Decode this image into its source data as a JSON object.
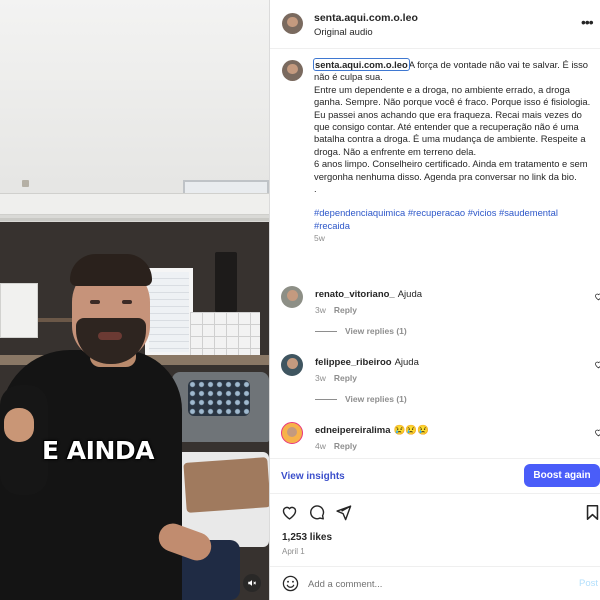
{
  "video": {
    "caption": "E AINDA",
    "mute_icon": "speaker-muted-icon"
  },
  "header": {
    "username": "senta.aqui.com.o.leo",
    "subtitle": "Original audio",
    "more_icon": "more-horizontal-icon",
    "more_glyph": "•••"
  },
  "post": {
    "username": "senta.aqui.com.o.leo",
    "lines": [
      "A força de vontade não vai te salvar. É isso não é culpa sua.",
      "Entre um dependente e a droga, no ambiente errado, a droga ganha. Sempre. Não porque você é fraco. Porque isso é fisiologia.",
      "Eu passei anos achando que era fraqueza. Recai mais vezes do que consigo contar. Até entender que a recuperação não é uma batalha contra a droga. É uma mudança de ambiente. Respeite a droga. Não a enfrente em terreno dela.",
      "6 anos limpo. Conselheiro certificado. Ainda em tratamento e sem vergonha nenhuma disso. Agenda pra conversar no link da bio.",
      "."
    ],
    "hashtags": "#dependenciaquimica #recuperacao #vicios #saudemental #recaida",
    "time": "5w"
  },
  "comments": [
    {
      "username": "renato_vitoriano_",
      "text": "Ajuda",
      "time": "3w",
      "reply_label": "Reply",
      "view_replies": "View replies (1)"
    },
    {
      "username": "felippee_ribeiroo",
      "text": "Ajuda",
      "time": "3w",
      "reply_label": "Reply",
      "view_replies": "View replies (1)"
    },
    {
      "username": "edneipereiralima",
      "text": "😢😢😢",
      "time": "4w",
      "reply_label": "Reply"
    }
  ],
  "insights": {
    "link_label": "View insights",
    "boost_label": "Boost again"
  },
  "actions": {
    "likes": "1,253 likes",
    "date": "April 1",
    "icons": [
      "heart-icon",
      "comment-icon",
      "share-icon",
      "bookmark-icon"
    ]
  },
  "add_comment": {
    "placeholder": "Add a comment...",
    "post_label": "Post",
    "emoji_icon": "emoji-icon"
  },
  "colors": {
    "accent_blue": "#4a5df9",
    "link_blue": "#2d57c9",
    "muted_gray": "#8e8e8e",
    "text_dark": "#262626"
  }
}
